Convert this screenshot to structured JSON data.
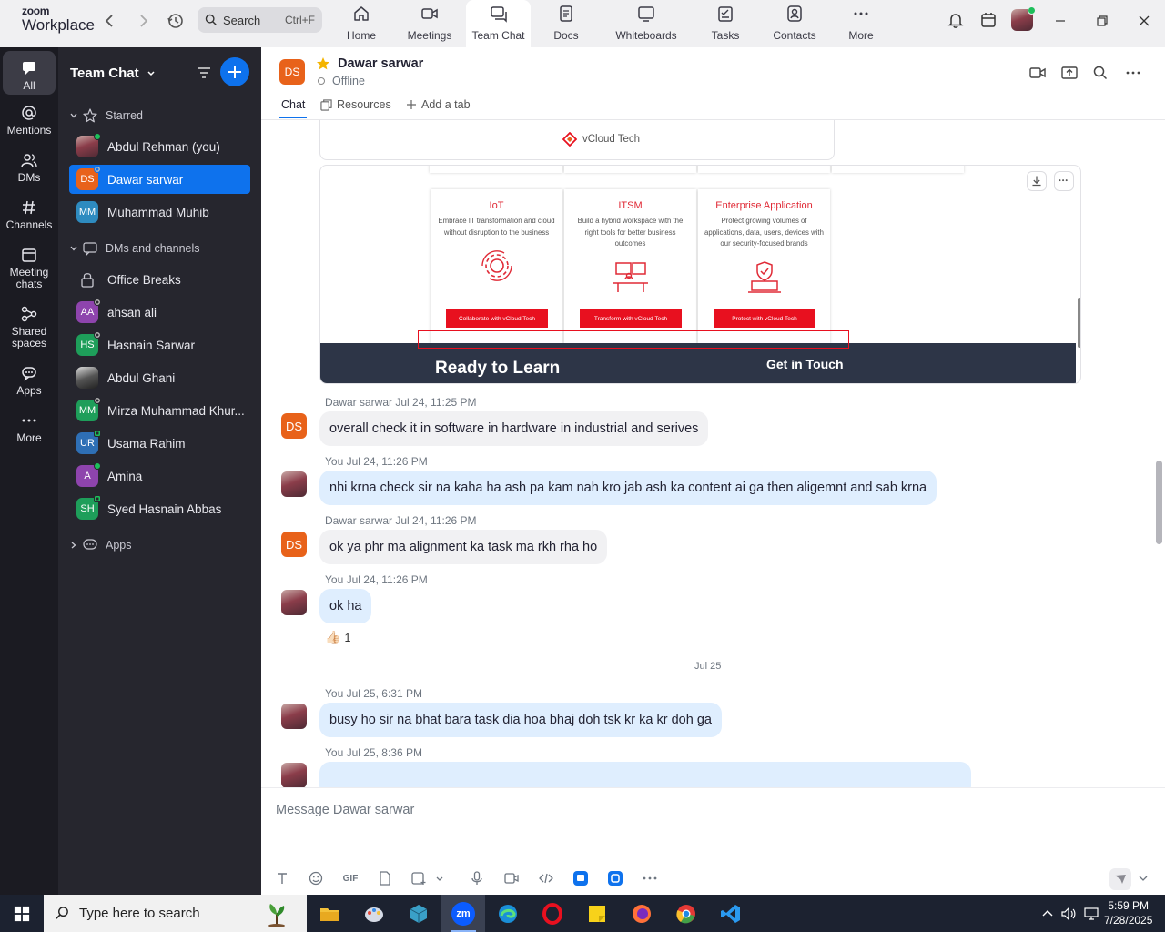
{
  "app": {
    "logo_top": "zoom",
    "logo_bottom": "Workplace"
  },
  "search": {
    "label": "Search",
    "shortcut": "Ctrl+F"
  },
  "top_tabs": [
    {
      "label": "Home",
      "icon": "home-icon"
    },
    {
      "label": "Meetings",
      "icon": "video-camera-icon"
    },
    {
      "label": "Team Chat",
      "icon": "chat-bubble-icon",
      "active": true
    },
    {
      "label": "Docs",
      "icon": "document-icon"
    },
    {
      "label": "Whiteboards",
      "icon": "whiteboard-icon"
    },
    {
      "label": "Tasks",
      "icon": "tasks-icon"
    },
    {
      "label": "Contacts",
      "icon": "contacts-icon"
    },
    {
      "label": "More",
      "icon": "more-dots-icon"
    }
  ],
  "rail": [
    {
      "label": "All",
      "icon": "chat-bubble-icon",
      "active": true
    },
    {
      "label": "Mentions",
      "icon": "at-icon"
    },
    {
      "label": "DMs",
      "icon": "people-icon"
    },
    {
      "label": "Channels",
      "icon": "hash-icon"
    },
    {
      "label": "Meeting chats",
      "icon": "calendar-icon"
    },
    {
      "label": "Shared spaces",
      "icon": "shared-spaces-icon"
    },
    {
      "label": "Apps",
      "icon": "apps-icon"
    },
    {
      "label": "More",
      "icon": "more-dots-icon"
    }
  ],
  "sidebar": {
    "title": "Team Chat",
    "starred_label": "Starred",
    "starred": [
      {
        "name": "Abdul Rehman (you)",
        "avatar": "photo",
        "status": "on"
      },
      {
        "name": "Dawar sarwar",
        "initials": "DS",
        "color": "#e8621a",
        "status": "off",
        "selected": true
      },
      {
        "name": "Muhammad Muhib",
        "initials": "MM",
        "color": "#2e8bc0",
        "status": "none"
      }
    ],
    "dms_label": "DMs and channels",
    "dms": [
      {
        "name": "Office Breaks",
        "avatar": "lock"
      },
      {
        "name": "ahsan ali",
        "initials": "AA",
        "color": "#8e44ad",
        "status": "off"
      },
      {
        "name": "Hasnain Sarwar",
        "initials": "HS",
        "color": "#1e9e5a",
        "status": "off"
      },
      {
        "name": "Abdul Ghani",
        "avatar": "photo2",
        "status": "none"
      },
      {
        "name": "Mirza Muhammad Khur...",
        "initials": "MM",
        "color": "#1e9e5a",
        "status": "off"
      },
      {
        "name": "Usama Rahim",
        "initials": "UR",
        "color": "#2e6fb5",
        "status": "sq"
      },
      {
        "name": "Amina",
        "initials": "A",
        "color": "#8e44ad",
        "status": "on"
      },
      {
        "name": "Syed Hasnain Abbas",
        "initials": "SH",
        "color": "#1e9e5a",
        "status": "sq"
      }
    ],
    "apps_label": "Apps"
  },
  "chat_header": {
    "initials": "DS",
    "name": "Dawar sarwar",
    "status": "Offline",
    "tabs": {
      "chat": "Chat",
      "resources": "Resources",
      "add_tab": "Add a tab"
    }
  },
  "attachment": {
    "card_label": "vCloud Tech",
    "services": [
      {
        "title": "IoT",
        "desc": "Embrace IT transformation and cloud without disruption to the business",
        "button": "Collaborate with vCloud Tech"
      },
      {
        "title": "ITSM",
        "desc": "Build a hybrid workspace with the right tools for better business outcomes",
        "button": "Transform with vCloud Tech"
      },
      {
        "title": "Enterprise Application",
        "desc": "Protect growing volumes of applications, data, users, devices with our security-focused brands",
        "button": "Protect with vCloud Tech"
      }
    ],
    "banner_left": "Ready to Learn",
    "banner_right": "Get in Touch"
  },
  "messages": [
    {
      "meta": "Dawar sarwar Jul 24, 11:25 PM",
      "text": "overall check it in software in hardware in industrial and serives",
      "from": "them"
    },
    {
      "meta": "You Jul 24, 11:26 PM",
      "text": "nhi krna check sir na kaha ha ash pa kam nah kro jab  ash ka content ai ga then aligemnt and sab krna",
      "from": "me"
    },
    {
      "meta": "Dawar sarwar Jul 24, 11:26 PM",
      "text": "ok ya phr ma alignment ka task ma rkh rha ho",
      "from": "them"
    },
    {
      "meta": "You Jul 24, 11:26 PM",
      "text": "ok ha",
      "from": "me"
    },
    {
      "meta": "You Jul 25, 6:31 PM",
      "text": "busy ho sir na bhat bara task dia hoa bhaj doh tsk kr ka kr doh ga",
      "from": "me"
    },
    {
      "meta": "You Jul 25, 8:36 PM",
      "text": "",
      "from": "me"
    }
  ],
  "reaction": {
    "emoji": "👍🏻",
    "count": "1"
  },
  "date_separator": "Jul 25",
  "composer": {
    "placeholder": "Message Dawar sarwar",
    "gif": "GIF"
  },
  "taskbar": {
    "search_placeholder": "Type here to search",
    "time": "5:59 PM",
    "date": "7/28/2025",
    "zoom_label": "zm"
  }
}
